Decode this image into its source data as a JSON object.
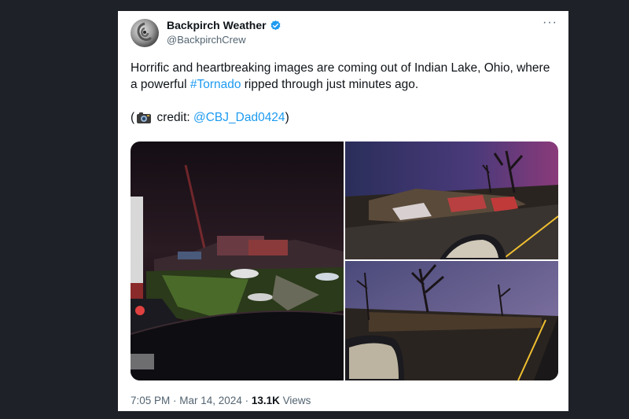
{
  "post": {
    "display_name": "Backpirch Weather",
    "handle": "@BackpirchCrew",
    "more_icon": "more-horizontal-icon",
    "verified_icon": "verified-badge-icon",
    "text_before_hashtag": "Horrific and heartbreaking images are coming out of Indian Lake, Ohio, where a powerful ",
    "hashtag": "#Tornado",
    "text_after_hashtag": " ripped through just minutes ago.",
    "credit_open": "(",
    "credit_icon": "camera-icon",
    "credit_label": " credit: ",
    "credit_mention": "@CBJ_Dad0424",
    "credit_close": ")",
    "time": "7:05 PM",
    "separator": " · ",
    "date": "Mar 14, 2024",
    "views_count": "13.1K",
    "views_label": " Views"
  },
  "colors": {
    "link": "#1d9bf0",
    "verified": "#1d9bf0",
    "background": "#1e2128"
  }
}
